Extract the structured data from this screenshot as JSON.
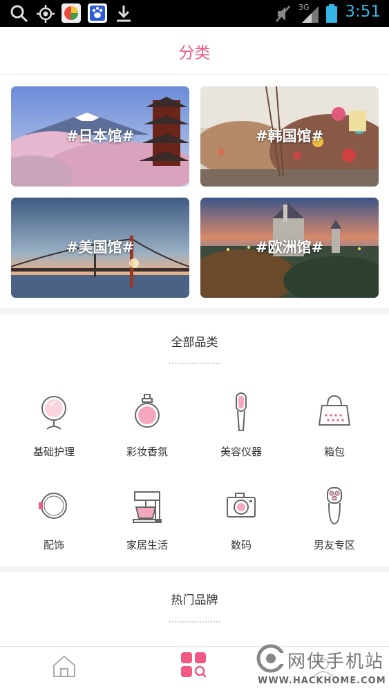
{
  "status_bar": {
    "time": "3:51",
    "network": "3G",
    "icons": [
      "search-icon",
      "location-icon",
      "app-store-icon",
      "baidu-icon",
      "download-icon",
      "mute-icon",
      "signal-icon",
      "battery-icon"
    ]
  },
  "header": {
    "title": "分类"
  },
  "countries": [
    {
      "label": "#日本馆#"
    },
    {
      "label": "#韩国馆#"
    },
    {
      "label": "#美国馆#"
    },
    {
      "label": "#欧洲馆#"
    }
  ],
  "all_categories": {
    "title": "全部品类",
    "items": [
      {
        "label": "基础护理",
        "icon": "mirror-icon"
      },
      {
        "label": "彩妆香氛",
        "icon": "perfume-icon"
      },
      {
        "label": "美容仪器",
        "icon": "beauty-device-icon"
      },
      {
        "label": "箱包",
        "icon": "handbag-icon"
      },
      {
        "label": "配饰",
        "icon": "watch-icon"
      },
      {
        "label": "家居生活",
        "icon": "mixer-icon"
      },
      {
        "label": "数码",
        "icon": "camera-icon"
      },
      {
        "label": "男友专区",
        "icon": "shaver-icon"
      }
    ]
  },
  "hot_brands": {
    "title": "热门品牌"
  },
  "tabbar": {
    "tabs": [
      "home-tab",
      "category-tab",
      "profile-tab"
    ]
  },
  "watermark": {
    "text": "网侠手机站",
    "url": "WWW.HACKHOME.COM"
  },
  "colors": {
    "accent": "#f05a82",
    "status_time": "#33b5e5"
  }
}
